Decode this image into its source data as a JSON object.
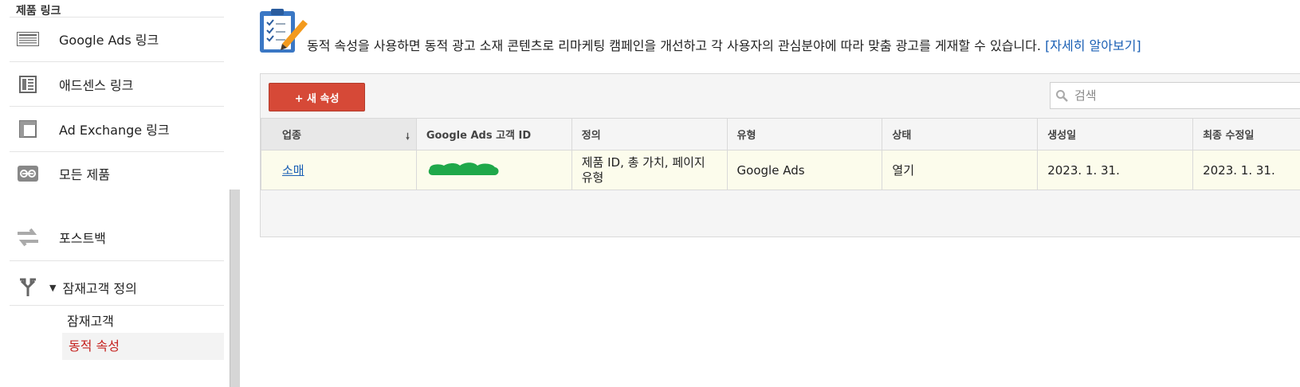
{
  "sidebar": {
    "section_title": "제품 링크",
    "items": [
      {
        "label": "Google Ads 링크",
        "icon": "google-ads-link-icon"
      },
      {
        "label": "애드센스 링크",
        "icon": "adsense-link-icon"
      },
      {
        "label": "Ad Exchange 링크",
        "icon": "ad-exchange-link-icon"
      },
      {
        "label": "모든 제품",
        "icon": "all-products-link-icon"
      },
      {
        "label": "포스트백",
        "icon": "postback-icon"
      }
    ],
    "audience_group": {
      "label": "잠재고객 정의",
      "icon": "audience-definition-icon",
      "expanded": true
    },
    "sub_items": [
      {
        "label": "잠재고객",
        "active": false
      },
      {
        "label": "동적 속성",
        "active": true
      }
    ]
  },
  "banner": {
    "icon": "clipboard-checklist-icon",
    "text": "동적 속성을 사용하면 동적 광고 소재 콘텐츠로 리마케팅 캠페인을 개선하고 각 사용자의 관심분야에 따라 맞춤 광고를 게재할 수 있습니다.",
    "link": "[자세히 알아보기]"
  },
  "toolbar": {
    "new_button": "+ 새 속성",
    "search_placeholder": "검색"
  },
  "table": {
    "columns": [
      "업종",
      "Google Ads 고객 ID",
      "정의",
      "유형",
      "상태",
      "생성일",
      "최종 수정일"
    ],
    "sorted_column": 0,
    "rows": [
      {
        "industry": "소매",
        "customer_id": "",
        "definition": "제품 ID, 총 가치, 페이지 유형",
        "type": "Google Ads",
        "status": "열기",
        "created": "2023. 1. 31.",
        "modified": "2023. 1. 31."
      }
    ]
  },
  "colors": {
    "accent_red": "#d64937",
    "active_nav": "#c5221f",
    "link_blue": "#1a5fb4",
    "row_highlight": "#fcfcec",
    "redaction_green": "#1fa84a"
  }
}
